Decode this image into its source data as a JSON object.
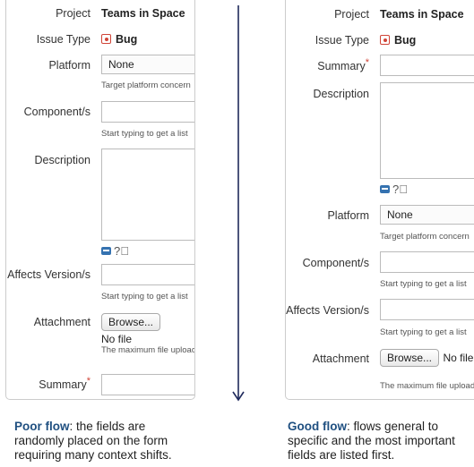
{
  "poor_form": {
    "project_label": "Project",
    "project_value": "Teams in Space",
    "issue_type_label": "Issue Type",
    "issue_type_value": "Bug",
    "platform_label": "Platform",
    "platform_value": "None",
    "platform_hint": "Target platform concern",
    "component_label": "Component/s",
    "component_hint": "Start typing to get a list",
    "description_label": "Description",
    "affects_label": "Affects Version/s",
    "affects_hint": "Start typing to get a list",
    "attachment_label": "Attachment",
    "browse_label": "Browse...",
    "no_file_text": "No file",
    "attachment_hint": "The maximum file upload",
    "summary_label": "Summary",
    "required_mark": "*"
  },
  "good_form": {
    "project_label": "Project",
    "project_value": "Teams in Space",
    "issue_type_label": "Issue Type",
    "issue_type_value": "Bug",
    "summary_label": "Summary",
    "required_mark": "*",
    "description_label": "Description",
    "platform_label": "Platform",
    "platform_value": "None",
    "platform_hint": "Target platform concern",
    "component_label": "Component/s",
    "component_hint": "Start typing to get a list",
    "affects_label": "Affects Version/s",
    "affects_hint": "Start typing to get a list",
    "attachment_label": "Attachment",
    "browse_label": "Browse...",
    "no_file_text": "No file",
    "attachment_hint": "The maximum file upload"
  },
  "captions": {
    "poor_title": "Poor flow",
    "poor_text": ": the fields are randomly placed on the form requiring many context shifts.",
    "good_title": "Good flow",
    "good_text": ": flows general to specific and the most important fields are listed first."
  },
  "icons": {
    "issue_type": "bug-icon",
    "formatting": "text-format-icon",
    "help": "help-icon",
    "flow": "arrow-down-icon"
  },
  "colors": {
    "bug": "#d04437",
    "arrow": "#1f2a5c",
    "caption_title": "#205081"
  }
}
